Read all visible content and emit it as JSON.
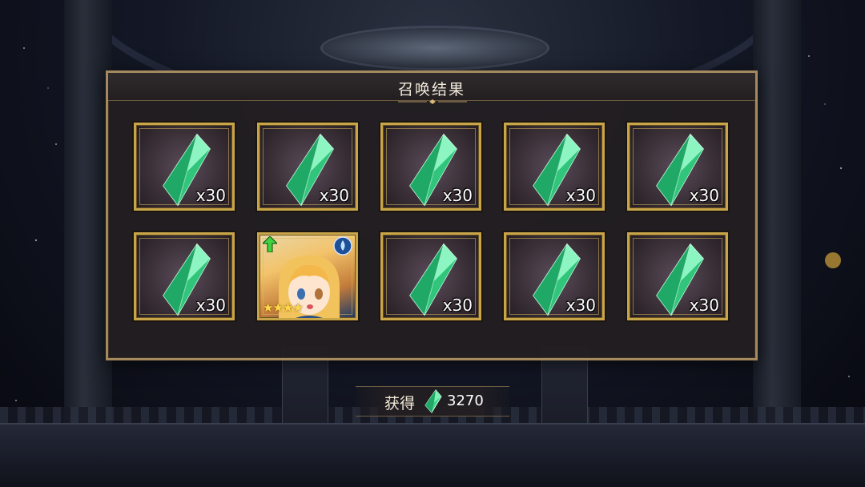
{
  "dialog": {
    "title": "召唤结果"
  },
  "results": [
    {
      "type": "crystal",
      "count": "x30"
    },
    {
      "type": "crystal",
      "count": "x30"
    },
    {
      "type": "crystal",
      "count": "x30"
    },
    {
      "type": "crystal",
      "count": "x30"
    },
    {
      "type": "crystal",
      "count": "x30"
    },
    {
      "type": "crystal",
      "count": "x30"
    },
    {
      "type": "character",
      "rarity_stars": "★★★★",
      "element_icon": "water-drop-icon",
      "badge_icon": "upgrade-arrow-icon"
    },
    {
      "type": "crystal",
      "count": "x30"
    },
    {
      "type": "crystal",
      "count": "x30"
    },
    {
      "type": "crystal",
      "count": "x30"
    }
  ],
  "obtain": {
    "label": "获得",
    "value": "3270",
    "icon": "crystal-icon"
  },
  "colors": {
    "frame_gold": "#c9a54a",
    "panel_border": "#a58a5e",
    "crystal_green": "#3fd68a"
  }
}
